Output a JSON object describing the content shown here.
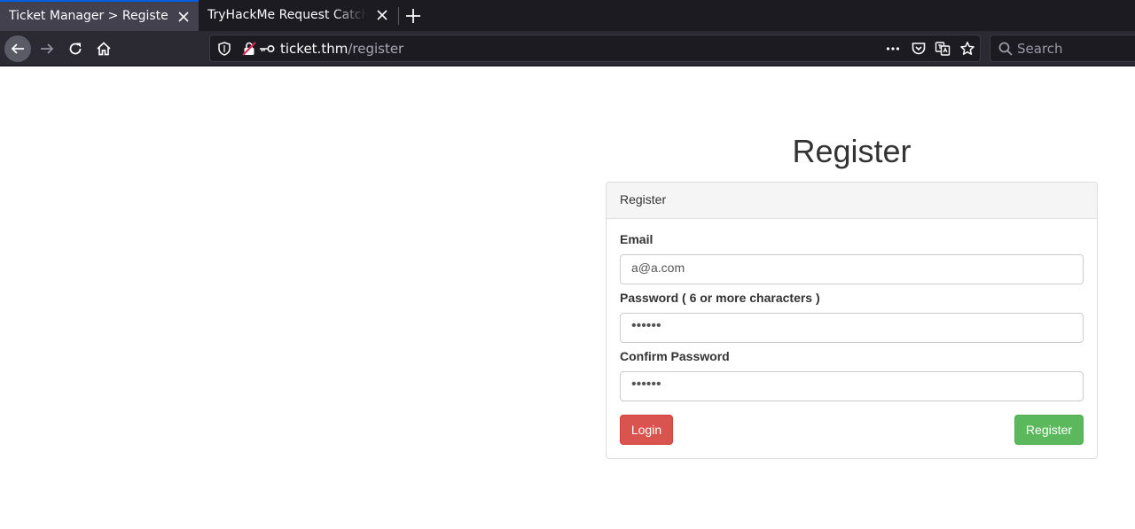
{
  "browser": {
    "tabs": [
      {
        "title": "Ticket Manager > Register",
        "active": true
      },
      {
        "title": "TryHackMe Request Catcher",
        "active": false
      }
    ],
    "url": {
      "host": "ticket.thm",
      "path": "/register"
    },
    "search_placeholder": "Search",
    "accent_color": "#0060df"
  },
  "page": {
    "heading": "Register",
    "panel_title": "Register",
    "email": {
      "label": "Email",
      "value": "a@a.com"
    },
    "password": {
      "label": "Password ( 6 or more characters )",
      "value": "••••••"
    },
    "confirm_password": {
      "label": "Confirm Password",
      "value": "••••••"
    },
    "login_button": "Login",
    "register_button": "Register",
    "colors": {
      "login": "#d9534f",
      "register": "#5cb85c"
    }
  }
}
